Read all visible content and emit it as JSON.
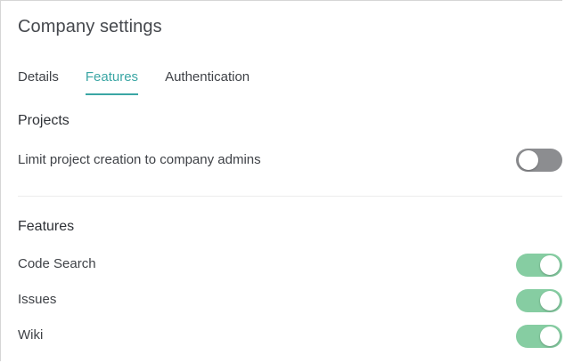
{
  "page": {
    "title": "Company settings"
  },
  "tabs": [
    {
      "label": "Details",
      "active": false
    },
    {
      "label": "Features",
      "active": true
    },
    {
      "label": "Authentication",
      "active": false
    }
  ],
  "projects": {
    "heading": "Projects",
    "settings": [
      {
        "label": "Limit project creation to company admins",
        "enabled": false
      }
    ]
  },
  "features": {
    "heading": "Features",
    "settings": [
      {
        "label": "Code Search",
        "enabled": true
      },
      {
        "label": "Issues",
        "enabled": true
      },
      {
        "label": "Wiki",
        "enabled": true
      }
    ]
  },
  "colors": {
    "accent": "#3aa6a4",
    "toggle_on": "#86cda2",
    "toggle_off": "#8c8d90"
  }
}
